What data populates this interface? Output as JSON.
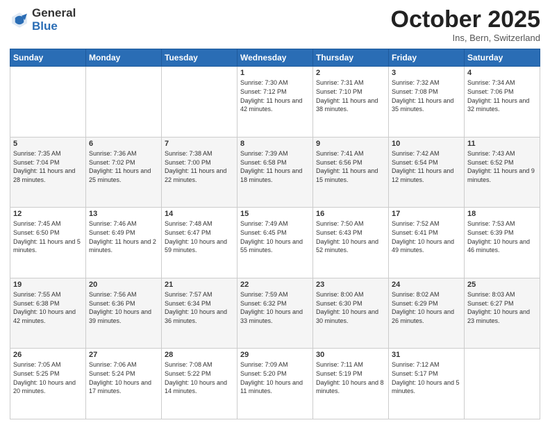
{
  "header": {
    "logo_general": "General",
    "logo_blue": "Blue",
    "month_title": "October 2025",
    "location": "Ins, Bern, Switzerland"
  },
  "weekdays": [
    "Sunday",
    "Monday",
    "Tuesday",
    "Wednesday",
    "Thursday",
    "Friday",
    "Saturday"
  ],
  "weeks": [
    [
      {
        "day": "",
        "sunrise": "",
        "sunset": "",
        "daylight": ""
      },
      {
        "day": "",
        "sunrise": "",
        "sunset": "",
        "daylight": ""
      },
      {
        "day": "",
        "sunrise": "",
        "sunset": "",
        "daylight": ""
      },
      {
        "day": "1",
        "sunrise": "Sunrise: 7:30 AM",
        "sunset": "Sunset: 7:12 PM",
        "daylight": "Daylight: 11 hours and 42 minutes."
      },
      {
        "day": "2",
        "sunrise": "Sunrise: 7:31 AM",
        "sunset": "Sunset: 7:10 PM",
        "daylight": "Daylight: 11 hours and 38 minutes."
      },
      {
        "day": "3",
        "sunrise": "Sunrise: 7:32 AM",
        "sunset": "Sunset: 7:08 PM",
        "daylight": "Daylight: 11 hours and 35 minutes."
      },
      {
        "day": "4",
        "sunrise": "Sunrise: 7:34 AM",
        "sunset": "Sunset: 7:06 PM",
        "daylight": "Daylight: 11 hours and 32 minutes."
      }
    ],
    [
      {
        "day": "5",
        "sunrise": "Sunrise: 7:35 AM",
        "sunset": "Sunset: 7:04 PM",
        "daylight": "Daylight: 11 hours and 28 minutes."
      },
      {
        "day": "6",
        "sunrise": "Sunrise: 7:36 AM",
        "sunset": "Sunset: 7:02 PM",
        "daylight": "Daylight: 11 hours and 25 minutes."
      },
      {
        "day": "7",
        "sunrise": "Sunrise: 7:38 AM",
        "sunset": "Sunset: 7:00 PM",
        "daylight": "Daylight: 11 hours and 22 minutes."
      },
      {
        "day": "8",
        "sunrise": "Sunrise: 7:39 AM",
        "sunset": "Sunset: 6:58 PM",
        "daylight": "Daylight: 11 hours and 18 minutes."
      },
      {
        "day": "9",
        "sunrise": "Sunrise: 7:41 AM",
        "sunset": "Sunset: 6:56 PM",
        "daylight": "Daylight: 11 hours and 15 minutes."
      },
      {
        "day": "10",
        "sunrise": "Sunrise: 7:42 AM",
        "sunset": "Sunset: 6:54 PM",
        "daylight": "Daylight: 11 hours and 12 minutes."
      },
      {
        "day": "11",
        "sunrise": "Sunrise: 7:43 AM",
        "sunset": "Sunset: 6:52 PM",
        "daylight": "Daylight: 11 hours and 9 minutes."
      }
    ],
    [
      {
        "day": "12",
        "sunrise": "Sunrise: 7:45 AM",
        "sunset": "Sunset: 6:50 PM",
        "daylight": "Daylight: 11 hours and 5 minutes."
      },
      {
        "day": "13",
        "sunrise": "Sunrise: 7:46 AM",
        "sunset": "Sunset: 6:49 PM",
        "daylight": "Daylight: 11 hours and 2 minutes."
      },
      {
        "day": "14",
        "sunrise": "Sunrise: 7:48 AM",
        "sunset": "Sunset: 6:47 PM",
        "daylight": "Daylight: 10 hours and 59 minutes."
      },
      {
        "day": "15",
        "sunrise": "Sunrise: 7:49 AM",
        "sunset": "Sunset: 6:45 PM",
        "daylight": "Daylight: 10 hours and 55 minutes."
      },
      {
        "day": "16",
        "sunrise": "Sunrise: 7:50 AM",
        "sunset": "Sunset: 6:43 PM",
        "daylight": "Daylight: 10 hours and 52 minutes."
      },
      {
        "day": "17",
        "sunrise": "Sunrise: 7:52 AM",
        "sunset": "Sunset: 6:41 PM",
        "daylight": "Daylight: 10 hours and 49 minutes."
      },
      {
        "day": "18",
        "sunrise": "Sunrise: 7:53 AM",
        "sunset": "Sunset: 6:39 PM",
        "daylight": "Daylight: 10 hours and 46 minutes."
      }
    ],
    [
      {
        "day": "19",
        "sunrise": "Sunrise: 7:55 AM",
        "sunset": "Sunset: 6:38 PM",
        "daylight": "Daylight: 10 hours and 42 minutes."
      },
      {
        "day": "20",
        "sunrise": "Sunrise: 7:56 AM",
        "sunset": "Sunset: 6:36 PM",
        "daylight": "Daylight: 10 hours and 39 minutes."
      },
      {
        "day": "21",
        "sunrise": "Sunrise: 7:57 AM",
        "sunset": "Sunset: 6:34 PM",
        "daylight": "Daylight: 10 hours and 36 minutes."
      },
      {
        "day": "22",
        "sunrise": "Sunrise: 7:59 AM",
        "sunset": "Sunset: 6:32 PM",
        "daylight": "Daylight: 10 hours and 33 minutes."
      },
      {
        "day": "23",
        "sunrise": "Sunrise: 8:00 AM",
        "sunset": "Sunset: 6:30 PM",
        "daylight": "Daylight: 10 hours and 30 minutes."
      },
      {
        "day": "24",
        "sunrise": "Sunrise: 8:02 AM",
        "sunset": "Sunset: 6:29 PM",
        "daylight": "Daylight: 10 hours and 26 minutes."
      },
      {
        "day": "25",
        "sunrise": "Sunrise: 8:03 AM",
        "sunset": "Sunset: 6:27 PM",
        "daylight": "Daylight: 10 hours and 23 minutes."
      }
    ],
    [
      {
        "day": "26",
        "sunrise": "Sunrise: 7:05 AM",
        "sunset": "Sunset: 5:25 PM",
        "daylight": "Daylight: 10 hours and 20 minutes."
      },
      {
        "day": "27",
        "sunrise": "Sunrise: 7:06 AM",
        "sunset": "Sunset: 5:24 PM",
        "daylight": "Daylight: 10 hours and 17 minutes."
      },
      {
        "day": "28",
        "sunrise": "Sunrise: 7:08 AM",
        "sunset": "Sunset: 5:22 PM",
        "daylight": "Daylight: 10 hours and 14 minutes."
      },
      {
        "day": "29",
        "sunrise": "Sunrise: 7:09 AM",
        "sunset": "Sunset: 5:20 PM",
        "daylight": "Daylight: 10 hours and 11 minutes."
      },
      {
        "day": "30",
        "sunrise": "Sunrise: 7:11 AM",
        "sunset": "Sunset: 5:19 PM",
        "daylight": "Daylight: 10 hours and 8 minutes."
      },
      {
        "day": "31",
        "sunrise": "Sunrise: 7:12 AM",
        "sunset": "Sunset: 5:17 PM",
        "daylight": "Daylight: 10 hours and 5 minutes."
      },
      {
        "day": "",
        "sunrise": "",
        "sunset": "",
        "daylight": ""
      }
    ]
  ]
}
